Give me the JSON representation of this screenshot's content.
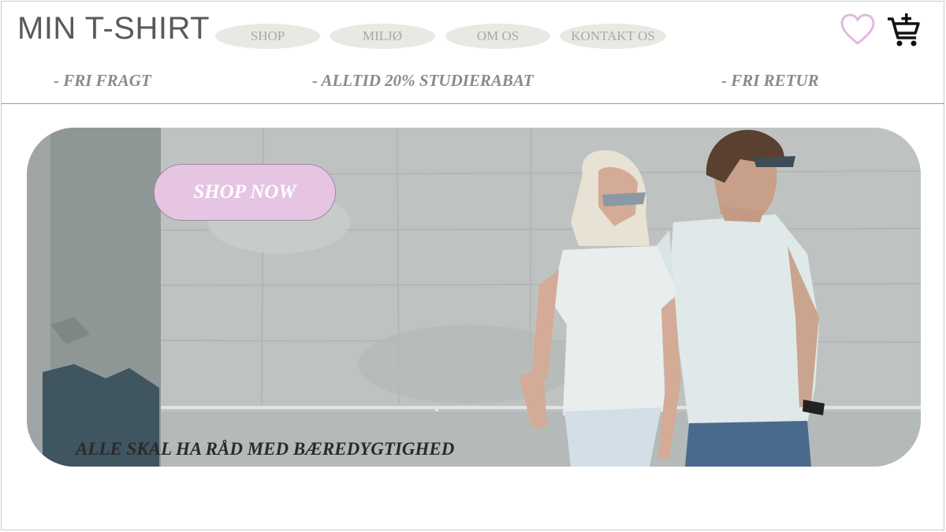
{
  "header": {
    "logo": "MIN T-SHIRT",
    "nav": [
      {
        "label": "SHOP"
      },
      {
        "label": "MILJØ"
      },
      {
        "label": "OM OS"
      },
      {
        "label": "KONTAKT OS"
      }
    ],
    "icons": {
      "wishlist": "heart-icon",
      "cart": "add-to-cart-icon"
    }
  },
  "promo_bar": [
    {
      "text": "- FRI FRAGT"
    },
    {
      "text": "- ALLTID 20% STUDIERABAT"
    },
    {
      "text": "- FRI RETUR"
    }
  ],
  "hero": {
    "cta_label": "SHOP NOW",
    "tagline": "ALLE SKAL HA RÅD MED BÆREDYGTIGHED"
  },
  "colors": {
    "accent_pink": "#e6c5e3",
    "heart_pink": "#e3b8e0",
    "nav_pill": "#e9e9e3",
    "text_grey": "#8a8a8a"
  }
}
